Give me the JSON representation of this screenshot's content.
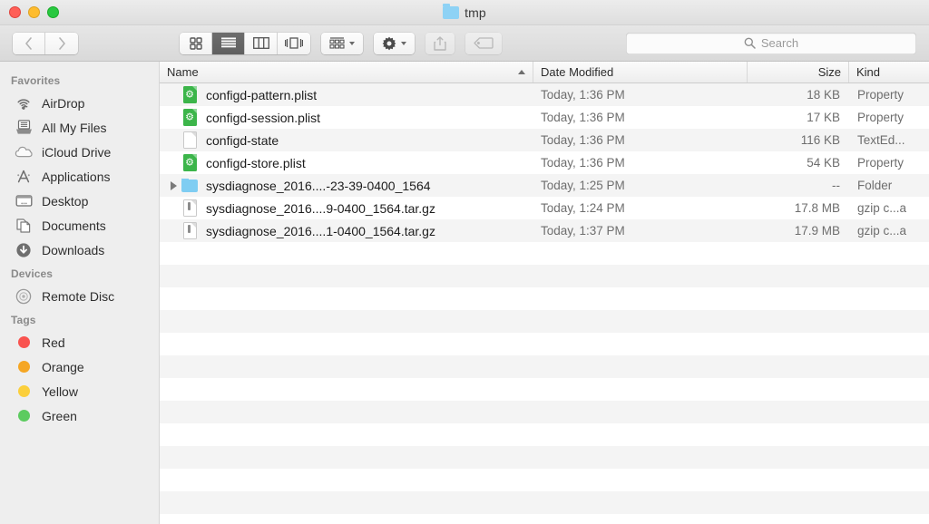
{
  "window": {
    "title": "tmp",
    "title_icon": "folder-icon",
    "traffic_lights": [
      {
        "name": "close",
        "color": "#ff5f57"
      },
      {
        "name": "minimize",
        "color": "#febc2e"
      },
      {
        "name": "maximize",
        "color": "#28c840"
      }
    ]
  },
  "toolbar": {
    "back_icon": "chevron-left-icon",
    "forward_icon": "chevron-right-icon",
    "view_modes": [
      {
        "name": "icon-view",
        "icon": "grid-icon",
        "active": false
      },
      {
        "name": "list-view",
        "icon": "list-icon",
        "active": true
      },
      {
        "name": "column-view",
        "icon": "columns-icon",
        "active": false
      },
      {
        "name": "coverflow-view",
        "icon": "coverflow-icon",
        "active": false
      }
    ],
    "arrange": {
      "name": "arrange-button",
      "icon": "arrange-icon"
    },
    "action": {
      "name": "action-button",
      "icon": "gear-icon"
    },
    "share": {
      "name": "share-button",
      "icon": "share-icon"
    },
    "tag": {
      "name": "tag-button",
      "icon": "tag-icon"
    }
  },
  "search": {
    "placeholder": "Search",
    "icon": "search-icon",
    "value": ""
  },
  "sidebar": {
    "sections": [
      {
        "header": "Favorites",
        "items": [
          {
            "label": "AirDrop",
            "icon": "airdrop-icon"
          },
          {
            "label": "All My Files",
            "icon": "all-my-files-icon"
          },
          {
            "label": "iCloud Drive",
            "icon": "icloud-icon"
          },
          {
            "label": "Applications",
            "icon": "applications-icon"
          },
          {
            "label": "Desktop",
            "icon": "desktop-icon"
          },
          {
            "label": "Documents",
            "icon": "documents-icon"
          },
          {
            "label": "Downloads",
            "icon": "downloads-icon"
          }
        ]
      },
      {
        "header": "Devices",
        "items": [
          {
            "label": "Remote Disc",
            "icon": "disc-icon"
          }
        ]
      },
      {
        "header": "Tags",
        "items": [
          {
            "label": "Red",
            "icon": "tag-dot-icon",
            "color": "#f9534f"
          },
          {
            "label": "Orange",
            "icon": "tag-dot-icon",
            "color": "#f5a623"
          },
          {
            "label": "Yellow",
            "icon": "tag-dot-icon",
            "color": "#fbcf3c"
          },
          {
            "label": "Green",
            "icon": "tag-dot-icon",
            "color": "#5cd martin"
          }
        ]
      }
    ]
  },
  "filelist": {
    "columns": [
      {
        "key": "name",
        "label": "Name",
        "sorted": true,
        "sort_direction": "ascending"
      },
      {
        "key": "date",
        "label": "Date Modified"
      },
      {
        "key": "size",
        "label": "Size"
      },
      {
        "key": "kind",
        "label": "Kind"
      }
    ],
    "rows": [
      {
        "name": "configd-pattern.plist",
        "date": "Today, 1:36 PM",
        "size": "18 KB",
        "kind": "Property",
        "icon": "plist-file-icon",
        "expandable": false
      },
      {
        "name": "configd-session.plist",
        "date": "Today, 1:36 PM",
        "size": "17 KB",
        "kind": "Property",
        "icon": "plist-file-icon",
        "expandable": false
      },
      {
        "name": "configd-state",
        "date": "Today, 1:36 PM",
        "size": "116 KB",
        "kind": "TextEd...",
        "icon": "plain-file-icon",
        "expandable": false
      },
      {
        "name": "configd-store.plist",
        "date": "Today, 1:36 PM",
        "size": "54 KB",
        "kind": "Property",
        "icon": "plist-file-icon",
        "expandable": false
      },
      {
        "name": "sysdiagnose_2016....-23-39-0400_1564",
        "date": "Today, 1:25 PM",
        "size": "--",
        "kind": "Folder",
        "icon": "folder-icon",
        "expandable": true
      },
      {
        "name": "sysdiagnose_2016....9-0400_1564.tar.gz",
        "date": "Today, 1:24 PM",
        "size": "17.8 MB",
        "kind": "gzip c...a",
        "icon": "gzip-file-icon",
        "expandable": false
      },
      {
        "name": "sysdiagnose_2016....1-0400_1564.tar.gz",
        "date": "Today, 1:37 PM",
        "size": "17.9 MB",
        "kind": "gzip c...a",
        "icon": "gzip-file-icon",
        "expandable": false
      }
    ],
    "empty_row_count": 12
  }
}
